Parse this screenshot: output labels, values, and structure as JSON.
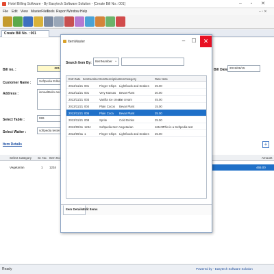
{
  "window": {
    "title": "Hotel Billing Software - By Easytech Software Solution - [Create Bill No.: 001]",
    "buttons": [
      "–",
      "▫",
      "✕"
    ]
  },
  "menu": [
    "File",
    "Edit",
    "View",
    "MasterFiles",
    "Tools",
    "Report",
    "Window",
    "Help"
  ],
  "document_tab": "Create Bill No. : 001",
  "form": {
    "bill_no_label": "Bill no. :",
    "bill_no_value": "001",
    "customer_name_label": "Customer Name :",
    "customer_name_value": "Softpedia Editor",
    "address_label": "Address :",
    "address_value": "ismaelBulin and no. 3b",
    "bill_date_label": "Bill Date :",
    "bill_date_value": "2019/09/15",
    "select_table_label": "Select Table :",
    "select_table_value": "999",
    "select_waiter_label": "Select Waiter :",
    "select_waiter_value": "softpedia tester",
    "item_details_label": "Item Details",
    "add_button": "+"
  },
  "bill_grid": {
    "headers": [
      "Select Category",
      "Sr. No.",
      "Item No",
      "Amount"
    ],
    "row": {
      "category": "Vegetarian",
      "sr_no": "1",
      "item_no": "1234",
      "amount": "465.00"
    }
  },
  "status": {
    "left": "Ready",
    "right": "Powered by - Easytech Software Solution"
  },
  "dialog": {
    "title": "ItemMaster",
    "search_by_label": "Search Item By:",
    "search_by_value": "ItemNumber",
    "search_value": "",
    "grid_headers": [
      "Entr.Date",
      "ItemNumber",
      "ItemDescription",
      "ItemCategory",
      "Rate",
      "Note"
    ],
    "rows": [
      {
        "date": "2013/11/21",
        "num": "001",
        "desc": "Pinger Chips",
        "cat": "Lightfoods and Snakes",
        "rate": "25.00",
        "note": "",
        "selected": false
      },
      {
        "date": "2013/11/21",
        "num": "001",
        "desc": "Very Kansas",
        "cat": "Bevar Plant",
        "rate": "20.00",
        "note": "",
        "selected": false
      },
      {
        "date": "2013/11/21",
        "num": "003",
        "desc": "Vanilla Ice cream",
        "cat": "Ice cream",
        "rate": "45.00",
        "note": "",
        "selected": false
      },
      {
        "date": "2013/11/21",
        "num": "004",
        "desc": "Plain Cocos",
        "cat": "Bevar Plant",
        "rate": "15.00",
        "note": "",
        "selected": false
      },
      {
        "date": "2013/11/21",
        "num": "005",
        "desc": "Plain Coca",
        "cat": "Bevar Plant",
        "rate": "25.00",
        "note": "",
        "selected": true
      },
      {
        "date": "2013/11/21",
        "num": "008",
        "desc": "Sprite",
        "cat": "Cold Drinks",
        "rate": "25.00",
        "note": "",
        "selected": false
      },
      {
        "date": "2013/09/11",
        "num": "1234",
        "desc": "Softpedia Item",
        "cat": "Vegetarian",
        "rate": "465.00",
        "note": "This is a Softpedia test",
        "selected": false
      },
      {
        "date": "2013/09/11",
        "num": "1",
        "desc": "Pinger Chips",
        "cat": "Lightfoods and Snakes",
        "rate": "25.00",
        "note": "",
        "selected": false
      }
    ],
    "tabs": [
      "Item Details",
      "Edit Items"
    ],
    "controls": {
      "minimize": "–",
      "maximize": "☐",
      "close": "✕"
    }
  },
  "colors": {
    "selection": "#1f70c8",
    "close_red": "#e81123",
    "link_blue": "#1c4fa3"
  },
  "icons": [
    "app-icon",
    "toolbar-icons",
    "dialog-icon"
  ]
}
